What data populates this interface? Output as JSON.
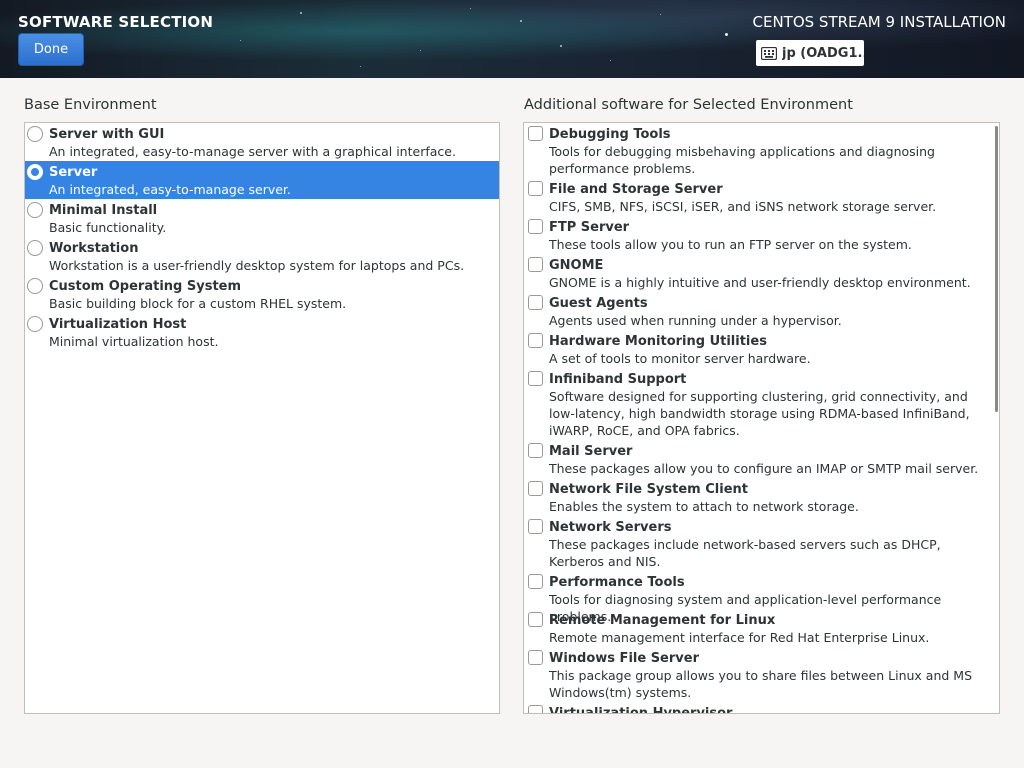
{
  "header": {
    "title": "SOFTWARE SELECTION",
    "done_label": "Done",
    "install_title": "CENTOS STREAM 9 INSTALLATION",
    "keyboard_layout": "jp (OADG1..."
  },
  "base_environment": {
    "label": "Base Environment",
    "items": [
      {
        "name": "Server with GUI",
        "description": "An integrated, easy-to-manage server with a graphical interface.",
        "selected": false
      },
      {
        "name": "Server",
        "description": "An integrated, easy-to-manage server.",
        "selected": true
      },
      {
        "name": "Minimal Install",
        "description": "Basic functionality.",
        "selected": false
      },
      {
        "name": "Workstation",
        "description": "Workstation is a user-friendly desktop system for laptops and PCs.",
        "selected": false
      },
      {
        "name": "Custom Operating System",
        "description": "Basic building block for a custom RHEL system.",
        "selected": false
      },
      {
        "name": "Virtualization Host",
        "description": "Minimal virtualization host.",
        "selected": false
      }
    ]
  },
  "additional_software": {
    "label": "Additional software for Selected Environment",
    "items": [
      {
        "name": "Debugging Tools",
        "description": "Tools for debugging misbehaving applications and diagnosing performance problems.",
        "checked": false
      },
      {
        "name": "File and Storage Server",
        "description": "CIFS, SMB, NFS, iSCSI, iSER, and iSNS network storage server.",
        "checked": false
      },
      {
        "name": "FTP Server",
        "description": "These tools allow you to run an FTP server on the system.",
        "checked": false
      },
      {
        "name": "GNOME",
        "description": "GNOME is a highly intuitive and user-friendly desktop environment.",
        "checked": false
      },
      {
        "name": "Guest Agents",
        "description": "Agents used when running under a hypervisor.",
        "checked": false
      },
      {
        "name": "Hardware Monitoring Utilities",
        "description": "A set of tools to monitor server hardware.",
        "checked": false
      },
      {
        "name": "Infiniband Support",
        "description": "Software designed for supporting clustering, grid connectivity, and low-latency, high bandwidth storage using RDMA-based InfiniBand, iWARP, RoCE, and OPA fabrics.",
        "checked": false
      },
      {
        "name": "Mail Server",
        "description": "These packages allow you to configure an IMAP or SMTP mail server.",
        "checked": false
      },
      {
        "name": "Network File System Client",
        "description": "Enables the system to attach to network storage.",
        "checked": false
      },
      {
        "name": "Network Servers",
        "description": "These packages include network-based servers such as DHCP, Kerberos and NIS.",
        "checked": false
      },
      {
        "name": "Performance Tools",
        "description": "Tools for diagnosing system and application-level performance problems.",
        "checked": false
      },
      {
        "name": "Remote Management for Linux",
        "description": "Remote management interface for Red Hat Enterprise Linux.",
        "checked": false
      },
      {
        "name": "Windows File Server",
        "description": "This package group allows you to share files between Linux and MS Windows(tm) systems.",
        "checked": false
      },
      {
        "name": "Virtualization Hypervisor",
        "description": "",
        "checked": false
      }
    ]
  }
}
